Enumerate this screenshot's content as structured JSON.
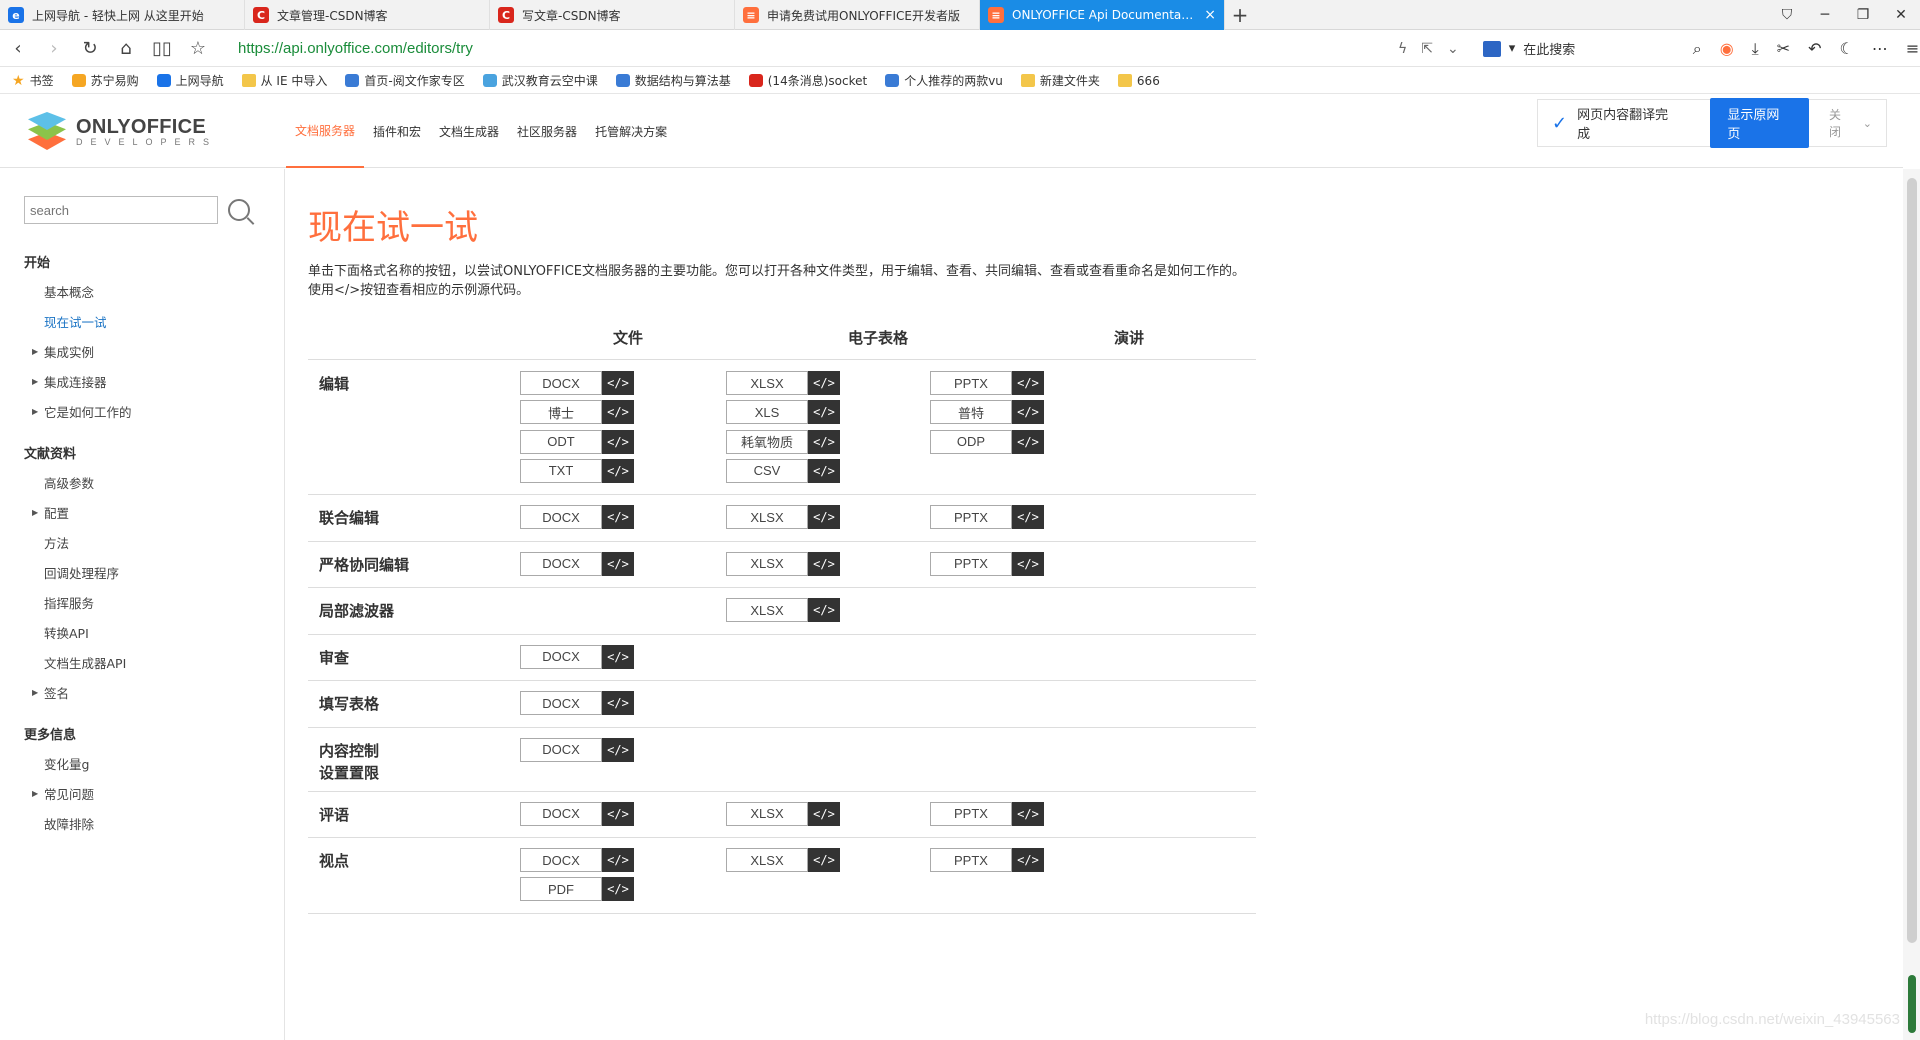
{
  "browser": {
    "tabs": [
      {
        "label": "上网导航 - 轻快上网 从这里开始",
        "icon_color": "#1a73e8",
        "icon_glyph": "e",
        "active": false
      },
      {
        "label": "文章管理-CSDN博客",
        "icon_color": "#d9261c",
        "icon_glyph": "C",
        "active": false
      },
      {
        "label": "写文章-CSDN博客",
        "icon_color": "#d9261c",
        "icon_glyph": "C",
        "active": false
      },
      {
        "label": "申请免费试用ONLYOFFICE开发者版",
        "icon_color": "#ff6f3d",
        "icon_glyph": "≡",
        "active": false
      },
      {
        "label": "ONLYOFFICE Api Documentation",
        "icon_color": "#ff6f3d",
        "icon_glyph": "≡",
        "active": true
      }
    ],
    "url": "https://api.onlyoffice.com/editors/try",
    "search_placeholder": "在此搜索",
    "bookmarks": [
      {
        "label": "书签",
        "icon": "star-icon"
      },
      {
        "label": "苏宁易购",
        "icon": "suning-icon"
      },
      {
        "label": "上网导航",
        "icon": "ie-icon"
      },
      {
        "label": "从 IE 中导入",
        "icon": "folder-icon"
      },
      {
        "label": "首页-阅文作家专区",
        "icon": "page-icon"
      },
      {
        "label": "武汉教育云空中课",
        "icon": "cloud-icon"
      },
      {
        "label": "数据结构与算法基",
        "icon": "page-icon"
      },
      {
        "label": "(14条消息)socket",
        "icon": "csdn-icon"
      },
      {
        "label": "个人推荐的两款vu",
        "icon": "page-icon"
      },
      {
        "label": "新建文件夹",
        "icon": "folder-icon"
      },
      {
        "label": "666",
        "icon": "folder-icon"
      }
    ]
  },
  "header": {
    "logo_title": "ONLYOFFICE",
    "logo_sub": "DEVELOPERS",
    "nav": [
      {
        "label": "文档服务器",
        "active": true
      },
      {
        "label": "插件和宏",
        "active": false
      },
      {
        "label": "文档生成器",
        "active": false
      },
      {
        "label": "社区服务器",
        "active": false
      },
      {
        "label": "托管解决方案",
        "active": false
      }
    ]
  },
  "translate_bar": {
    "message": "网页内容翻译完成",
    "show_original": "显示原网页",
    "close": "关闭"
  },
  "sidebar": {
    "search_placeholder": "search",
    "sections": [
      {
        "title": "开始",
        "items": [
          {
            "label": "基本概念",
            "expandable": false,
            "active": false
          },
          {
            "label": "现在试一试",
            "expandable": false,
            "active": true
          },
          {
            "label": "集成实例",
            "expandable": true,
            "active": false
          },
          {
            "label": "集成连接器",
            "expandable": true,
            "active": false
          },
          {
            "label": "它是如何工作的",
            "expandable": true,
            "active": false
          }
        ]
      },
      {
        "title": "文献资料",
        "items": [
          {
            "label": "高级参数",
            "expandable": false,
            "active": false
          },
          {
            "label": "配置",
            "expandable": true,
            "active": false
          },
          {
            "label": "方法",
            "expandable": false,
            "active": false
          },
          {
            "label": "回调处理程序",
            "expandable": false,
            "active": false
          },
          {
            "label": "指挥服务",
            "expandable": false,
            "active": false
          },
          {
            "label": "转换API",
            "expandable": false,
            "active": false
          },
          {
            "label": "文档生成器API",
            "expandable": false,
            "active": false
          },
          {
            "label": "签名",
            "expandable": true,
            "active": false
          }
        ]
      },
      {
        "title": "更多信息",
        "items": [
          {
            "label": "变化量g",
            "expandable": false,
            "active": false
          },
          {
            "label": "常见问题",
            "expandable": true,
            "active": false
          },
          {
            "label": "故障排除",
            "expandable": false,
            "active": false
          }
        ]
      }
    ]
  },
  "main": {
    "title": "现在试一试",
    "intro": "单击下面格式名称的按钮，以尝试ONLYOFFICE文档服务器的主要功能。您可以打开各种文件类型，用于编辑、查看、共同编辑、查看或查看重命名是如何工作的。使用</>按钮查看相应的示例源代码。",
    "columns": [
      "文件",
      "电子表格",
      "演讲"
    ],
    "code_label": "</>",
    "rows": [
      {
        "label": "编辑",
        "cells": [
          [
            "DOCX",
            "博士",
            "ODT",
            "TXT"
          ],
          [
            "XLSX",
            "XLS",
            "耗氧物质",
            "CSV"
          ],
          [
            "PPTX",
            "普特",
            "ODP"
          ]
        ]
      },
      {
        "label": "联合编辑",
        "cells": [
          [
            "DOCX"
          ],
          [
            "XLSX"
          ],
          [
            "PPTX"
          ]
        ]
      },
      {
        "label": "严格协同编辑",
        "cells": [
          [
            "DOCX"
          ],
          [
            "XLSX"
          ],
          [
            "PPTX"
          ]
        ]
      },
      {
        "label": "局部滤波器",
        "cells": [
          [],
          [
            "XLSX"
          ],
          []
        ]
      },
      {
        "label": "审查",
        "cells": [
          [
            "DOCX"
          ],
          [],
          []
        ]
      },
      {
        "label": "填写表格",
        "cells": [
          [
            "DOCX"
          ],
          [],
          []
        ]
      },
      {
        "label": "内容控制\n设置置限",
        "cells": [
          [
            "DOCX"
          ],
          [],
          []
        ]
      },
      {
        "label": "评语",
        "cells": [
          [
            "DOCX"
          ],
          [
            "XLSX"
          ],
          [
            "PPTX"
          ]
        ]
      },
      {
        "label": "视点",
        "cells": [
          [
            "DOCX",
            "PDF"
          ],
          [
            "XLSX"
          ],
          [
            "PPTX"
          ]
        ]
      }
    ]
  },
  "watermark": "https://blog.csdn.net/weixin_43945563"
}
